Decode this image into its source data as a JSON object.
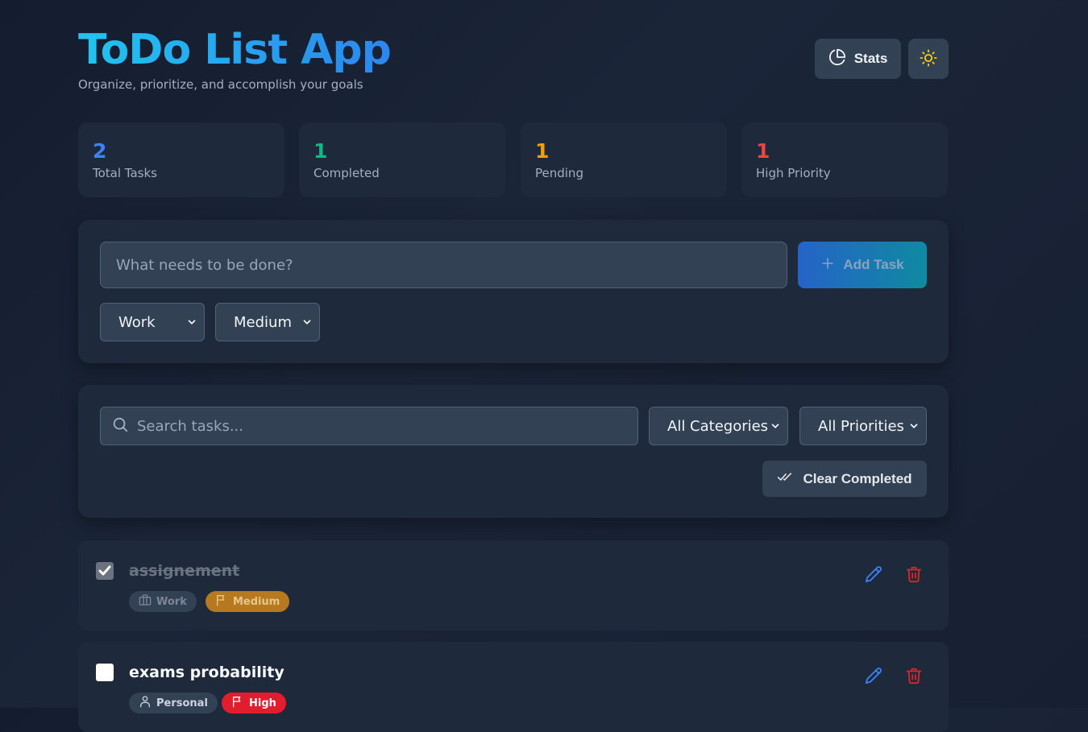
{
  "header": {
    "title": "ToDo List App",
    "subtitle": "Organize, prioritize, and accomplish your goals",
    "stats_label": "Stats",
    "stats_icon": "pie-chart-icon",
    "theme_icon": "sun-icon"
  },
  "stats": [
    {
      "value": "2",
      "label": "Total Tasks",
      "color": "#3b82f6"
    },
    {
      "value": "1",
      "label": "Completed",
      "color": "#10b981"
    },
    {
      "value": "1",
      "label": "Pending",
      "color": "#f59e0b"
    },
    {
      "value": "1",
      "label": "High Priority",
      "color": "#ef4444"
    }
  ],
  "add_task": {
    "placeholder": "What needs to be done?",
    "button_label": "Add Task",
    "category_value": "Work",
    "priority_value": "Medium"
  },
  "filters": {
    "search_placeholder": "Search tasks...",
    "category_filter": "All Categories",
    "priority_filter": "All Priorities",
    "clear_label": "Clear Completed"
  },
  "tasks": [
    {
      "title": "assignement",
      "completed": true,
      "category": "Work",
      "category_icon": "briefcase-icon",
      "priority": "Medium",
      "priority_color": "#b7791f"
    },
    {
      "title": "exams probability",
      "completed": false,
      "category": "Personal",
      "category_icon": "user-icon",
      "priority": "High",
      "priority_color": "#e11d2e"
    }
  ],
  "colors": {
    "accent_blue": "#3b82f6",
    "danger_red": "#ef4444",
    "edit_icon": "#3b82f6",
    "delete_icon": "#dc2626"
  }
}
